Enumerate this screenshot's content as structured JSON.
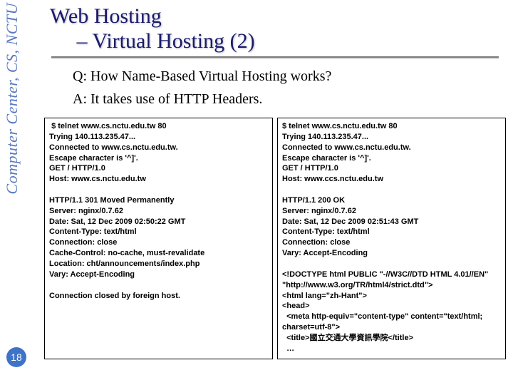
{
  "sidebar": {
    "org": "Computer Center, CS, NCTU"
  },
  "page": {
    "number": "18"
  },
  "title": {
    "line1": "Web Hosting",
    "line2": "– Virtual Hosting (2)"
  },
  "qa": {
    "q": "Q: How Name-Based Virtual Hosting works?",
    "a": "A: It takes use of HTTP Headers."
  },
  "panels": {
    "left": " $ telnet www.cs.nctu.edu.tw 80\nTrying 140.113.235.47...\nConnected to www.cs.nctu.edu.tw.\nEscape character is '^]'.\nGET / HTTP/1.0\nHost: www.cs.nctu.edu.tw\n\nHTTP/1.1 301 Moved Permanently\nServer: nginx/0.7.62\nDate: Sat, 12 Dec 2009 02:50:22 GMT\nContent-Type: text/html\nConnection: close\nCache-Control: no-cache, must-revalidate\nLocation: cht/announcements/index.php\nVary: Accept-Encoding\n\nConnection closed by foreign host.",
    "right": "$ telnet www.cs.nctu.edu.tw 80\nTrying 140.113.235.47...\nConnected to www.cs.nctu.edu.tw.\nEscape character is '^]'.\nGET / HTTP/1.0\nHost: www.ccs.nctu.edu.tw\n\nHTTP/1.1 200 OK\nServer: nginx/0.7.62\nDate: Sat, 12 Dec 2009 02:51:43 GMT\nContent-Type: text/html\nConnection: close\nVary: Accept-Encoding\n\n<!DOCTYPE html PUBLIC \"-//W3C//DTD HTML 4.01//EN\"\n\"http://www.w3.org/TR/html4/strict.dtd\">\n<html lang=\"zh-Hant\">\n<head>\n  <meta http-equiv=\"content-type\" content=\"text/html; charset=utf-8\">\n  <title>國立交通大學資訊學院</title>\n  …"
  }
}
